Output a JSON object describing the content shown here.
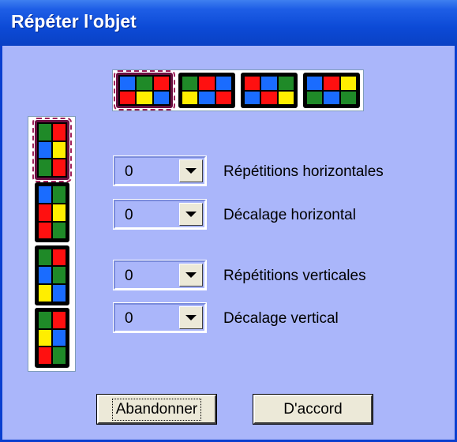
{
  "window": {
    "title": "Répéter l'objet"
  },
  "patterns": {
    "horizontal": [
      {
        "cells": [
          "b",
          "g",
          "r",
          "r",
          "y",
          "b"
        ]
      },
      {
        "cells": [
          "g",
          "r",
          "b",
          "y",
          "b",
          "r"
        ]
      },
      {
        "cells": [
          "r",
          "b",
          "g",
          "b",
          "r",
          "y"
        ]
      },
      {
        "cells": [
          "b",
          "r",
          "y",
          "g",
          "b",
          "g"
        ]
      }
    ],
    "vertical": [
      {
        "cells": [
          "g",
          "r",
          "b",
          "y",
          "g",
          "r"
        ]
      },
      {
        "cells": [
          "b",
          "g",
          "r",
          "y",
          "r",
          "g"
        ]
      },
      {
        "cells": [
          "g",
          "r",
          "b",
          "g",
          "y",
          "b"
        ]
      },
      {
        "cells": [
          "g",
          "r",
          "y",
          "b",
          "r",
          "g"
        ]
      }
    ],
    "selected_horizontal": 0,
    "selected_vertical": 0
  },
  "fields": {
    "h_repeat": {
      "value": "0",
      "label": "Répétitions horizontales"
    },
    "h_offset": {
      "value": "0",
      "label": "Décalage horizontal"
    },
    "v_repeat": {
      "value": "0",
      "label": "Répétitions verticales"
    },
    "v_offset": {
      "value": "0",
      "label": "Décalage vertical"
    }
  },
  "buttons": {
    "cancel": "Abandonner",
    "ok": "D'accord"
  },
  "colors": {
    "title_bar": "#0a41c4",
    "dialog_bg": "#aab6fa",
    "red": "#ff1010",
    "green": "#1f8a28",
    "blue": "#1a6cff",
    "yellow": "#ffee00"
  }
}
